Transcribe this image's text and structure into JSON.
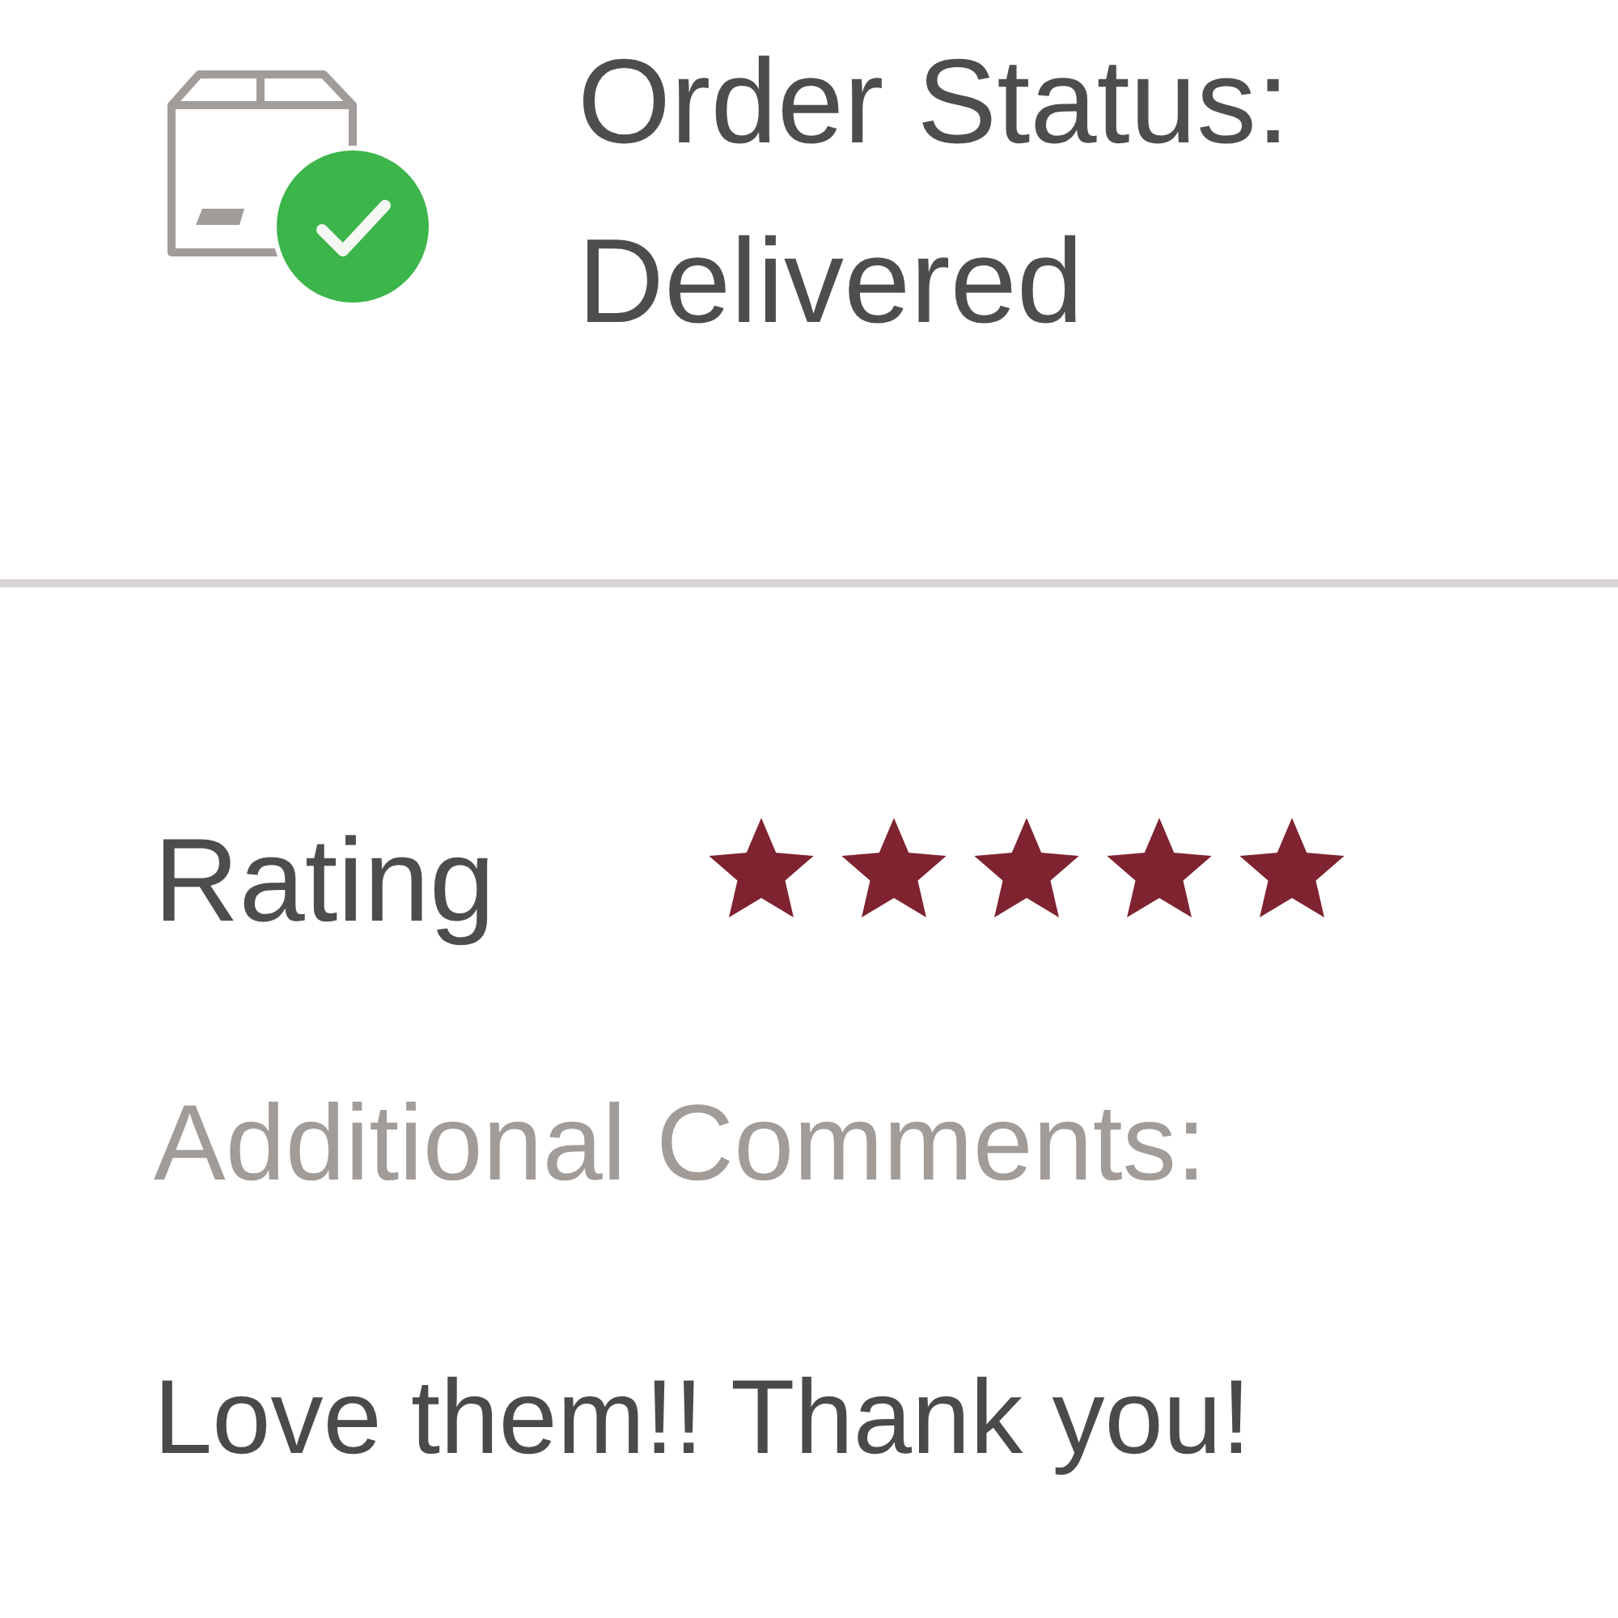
{
  "order_status": {
    "label": "Order Status:",
    "value": "Delivered"
  },
  "rating": {
    "label": "Rating",
    "stars": 5
  },
  "comments": {
    "label": "Additional Comments:",
    "text": "Love them!! Thank you!"
  }
}
